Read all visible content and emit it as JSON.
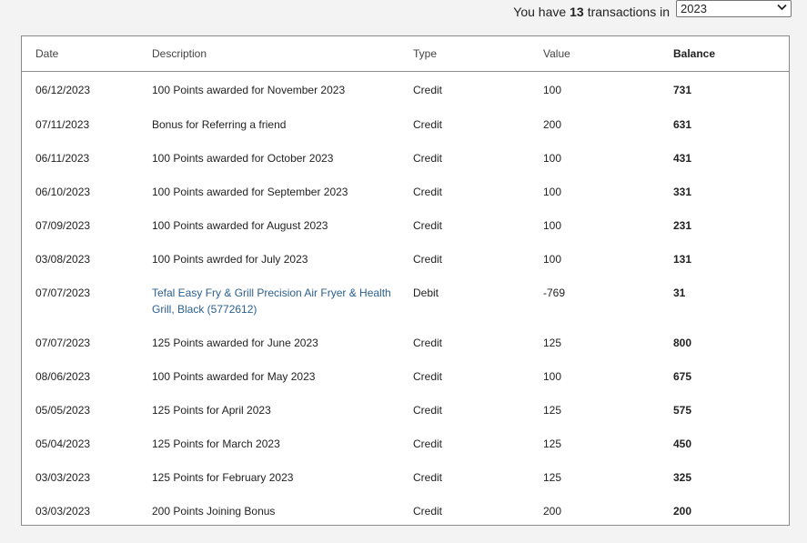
{
  "header": {
    "prefix": "You have",
    "count": "13",
    "suffix": "transactions in",
    "year_selected": "2023"
  },
  "table": {
    "columns": [
      "Date",
      "Description",
      "Type",
      "Value",
      "Balance"
    ],
    "rows": [
      {
        "date": "06/12/2023",
        "description": "100 Points awarded for November 2023",
        "type": "Credit",
        "value": "100",
        "balance": "731"
      },
      {
        "date": "07/11/2023",
        "description": "Bonus for Referring a friend",
        "type": "Credit",
        "value": "200",
        "balance": "631"
      },
      {
        "date": "06/11/2023",
        "description": "100 Points awarded for October 2023",
        "type": "Credit",
        "value": "100",
        "balance": "431"
      },
      {
        "date": "06/10/2023",
        "description": "100 Points awarded for September 2023",
        "type": "Credit",
        "value": "100",
        "balance": "331"
      },
      {
        "date": "07/09/2023",
        "description": "100 Points awarded for August 2023",
        "type": "Credit",
        "value": "100",
        "balance": "231"
      },
      {
        "date": "03/08/2023",
        "description": "100 Points awrded for July 2023",
        "type": "Credit",
        "value": "100",
        "balance": "131"
      },
      {
        "date": "07/07/2023",
        "description": "Tefal Easy Fry & Grill Precision Air Fryer & Health Grill, Black (5772612)",
        "type": "Debit",
        "value": "-769",
        "balance": "31",
        "is_link": true
      },
      {
        "date": "07/07/2023",
        "description": "125 Points awarded for June 2023",
        "type": "Credit",
        "value": "125",
        "balance": "800"
      },
      {
        "date": "08/06/2023",
        "description": "100 Points awarded for May 2023",
        "type": "Credit",
        "value": "100",
        "balance": "675"
      },
      {
        "date": "05/05/2023",
        "description": "125 Points for April 2023",
        "type": "Credit",
        "value": "125",
        "balance": "575"
      },
      {
        "date": "05/04/2023",
        "description": "125 Points for March 2023",
        "type": "Credit",
        "value": "125",
        "balance": "450"
      },
      {
        "date": "03/03/2023",
        "description": "125 Points for February 2023",
        "type": "Credit",
        "value": "125",
        "balance": "325"
      },
      {
        "date": "03/03/2023",
        "description": "200 Points Joining Bonus",
        "type": "Credit",
        "value": "200",
        "balance": "200"
      }
    ]
  },
  "colors": {
    "link": "#2b5f8f",
    "border": "#8a8a8a",
    "background": "#f3f3f3"
  },
  "icons": {
    "select_chevron": "chevron-down-icon"
  }
}
